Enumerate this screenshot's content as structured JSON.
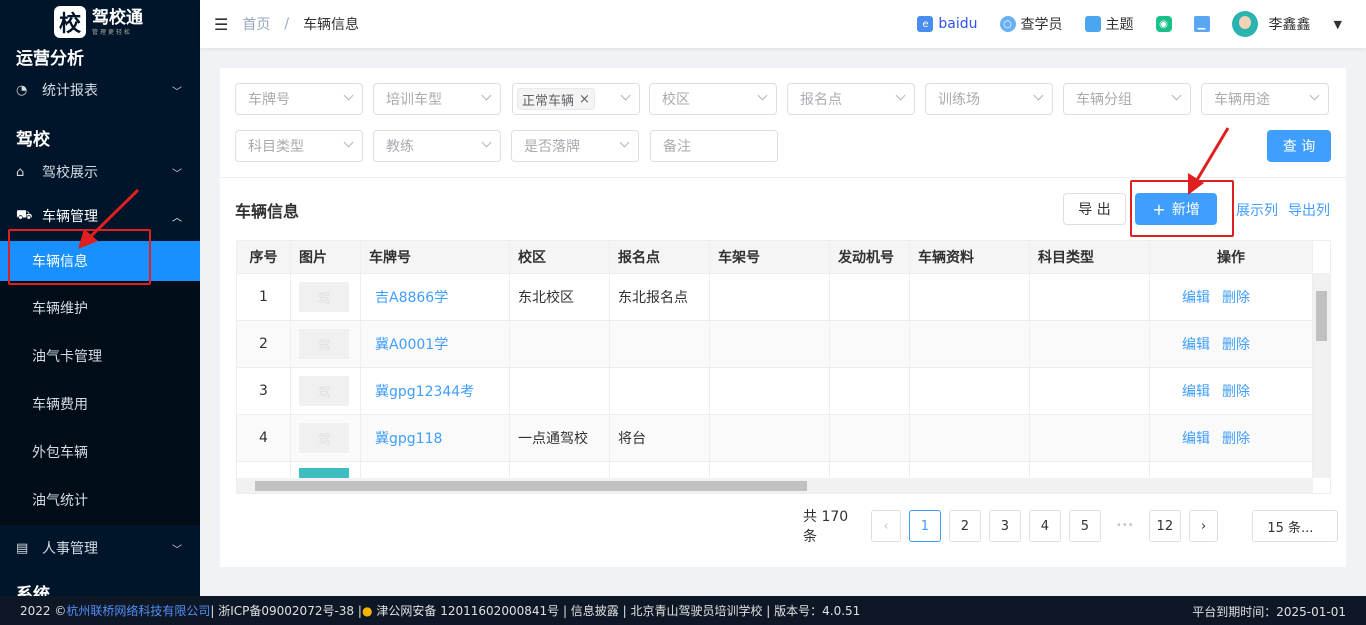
{
  "brand": {
    "logo_char": "校",
    "name": "驾校通",
    "slogan": "管理更轻松"
  },
  "sidebar": {
    "sections": [
      "运营分析",
      "驾校",
      "系统"
    ],
    "items": [
      {
        "label": "统计报表",
        "icon": "pie-chart-icon"
      },
      {
        "label": "驾校展示",
        "icon": "school-icon"
      },
      {
        "label": "车辆管理",
        "icon": "car-icon"
      },
      {
        "label": "人事管理",
        "icon": "id-card-icon"
      }
    ],
    "sub_items": [
      "车辆信息",
      "车辆维护",
      "油气卡管理",
      "车辆费用",
      "外包车辆",
      "油气统计"
    ]
  },
  "header": {
    "breadcrumb": [
      "首页",
      "车辆信息"
    ],
    "links": [
      {
        "label": "baidu",
        "icon": "ie-icon"
      },
      {
        "label": "查学员",
        "icon": "search-icon"
      },
      {
        "label": "主题",
        "icon": "tshirt-icon"
      }
    ],
    "user": "李鑫鑫"
  },
  "filters": {
    "row1": [
      "车牌号",
      "培训车型",
      "",
      "校区",
      "报名点",
      "训练场",
      "车辆分组",
      "车辆用途"
    ],
    "selected_tag": "正常车辆",
    "row2": [
      "科目类型",
      "教练",
      "是否落牌"
    ],
    "remark_placeholder": "备注",
    "query": "查 询"
  },
  "toolbar": {
    "title": "车辆信息",
    "export": "导 出",
    "add": "新增",
    "show_cols": "展示列",
    "export_cols": "导出列"
  },
  "table": {
    "columns": [
      "序号",
      "图片",
      "车牌号",
      "校区",
      "报名点",
      "车架号",
      "发动机号",
      "车辆资料",
      "科目类型",
      "操作"
    ],
    "rows": [
      {
        "no": "1",
        "plate": "吉A8866学",
        "campus": "东北校区",
        "signup": "东北报名点"
      },
      {
        "no": "2",
        "plate": "冀A0001学",
        "campus": "",
        "signup": ""
      },
      {
        "no": "3",
        "plate": "冀gpg12344考",
        "campus": "",
        "signup": ""
      },
      {
        "no": "4",
        "plate": "冀gpg118",
        "campus": "一点通驾校",
        "signup": "将台"
      }
    ],
    "placeholder_char": "驾",
    "edit": "编辑",
    "delete": "删除"
  },
  "pagination": {
    "total": "共 170 条",
    "pages": [
      "1",
      "2",
      "3",
      "4",
      "5",
      "12"
    ],
    "current": "1",
    "ellipsis": "•••",
    "page_size": "15 条..."
  },
  "footer": {
    "year": "2022 ©",
    "company": "杭州联桥网络科技有限公司",
    "icp": " | 浙ICP备09002072号-38 | ",
    "police": "津公网安备 12011602000841号 | 信息披露 | 北京青山驾驶员培训学校  | 版本号：4.0.51",
    "expire": "平台到期时间：2025-01-01"
  },
  "colors": {
    "sidebar": "#001529",
    "accent": "#409eff",
    "active_menu": "#1890ff",
    "highlight": "#e02020"
  }
}
